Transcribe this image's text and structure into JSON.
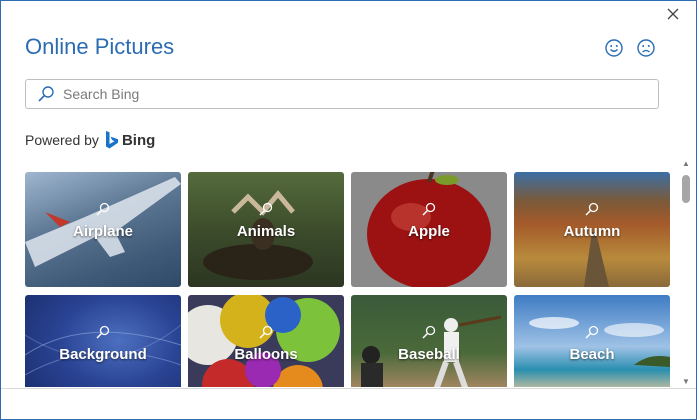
{
  "dialog": {
    "title": "Online Pictures",
    "close_icon": "close-icon",
    "feedback": {
      "happy_icon": "smiley-icon",
      "sad_icon": "frown-icon"
    }
  },
  "search": {
    "placeholder": "Search Bing",
    "value": ""
  },
  "powered_by": {
    "prefix": "Powered by",
    "brand": "Bing",
    "brand_color": "#1a73c8"
  },
  "tiles": [
    {
      "label": "Airplane"
    },
    {
      "label": "Animals"
    },
    {
      "label": "Apple"
    },
    {
      "label": "Autumn"
    },
    {
      "label": "Background"
    },
    {
      "label": "Balloons"
    },
    {
      "label": "Baseball"
    },
    {
      "label": "Beach"
    }
  ],
  "colors": {
    "accent": "#2b6cb3"
  }
}
